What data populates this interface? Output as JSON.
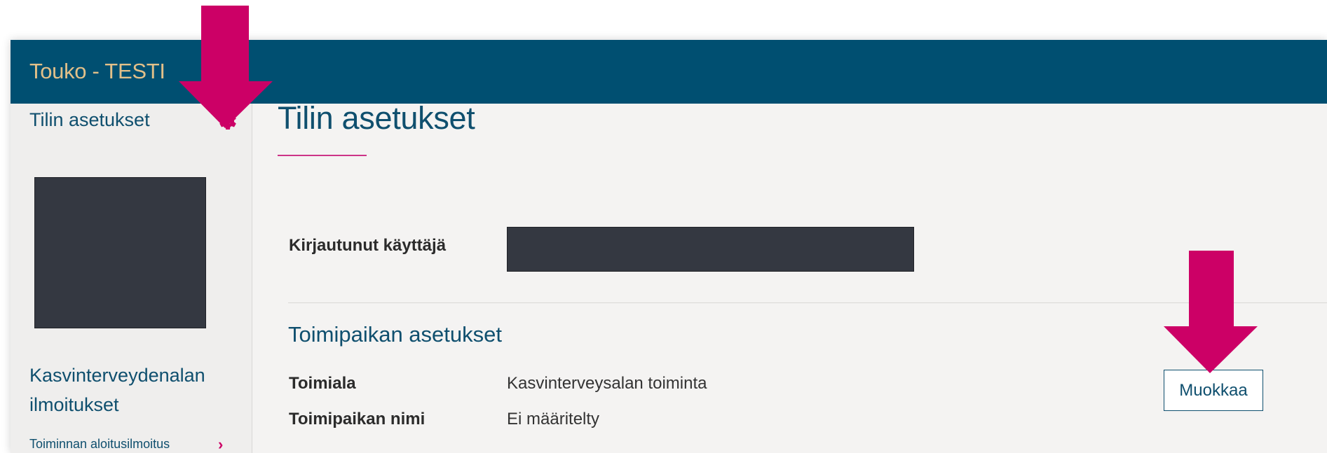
{
  "app": {
    "title": "Touko - TESTI"
  },
  "sidebar": {
    "settings_link": "Tilin asetukset",
    "settings_icon": "gear-icon",
    "section_heading": "Kasvinterveydenalan ilmoitukset",
    "items": [
      {
        "label": "Toiminnan aloitusilmoitus",
        "icon": "chevron-right-icon"
      }
    ]
  },
  "main": {
    "title": "Tilin asetukset",
    "logged_in_label": "Kirjautunut käyttäjä",
    "section_title": "Toimipaikan asetukset",
    "fields": [
      {
        "label": "Toimiala",
        "value": "Kasvinterveysalan toiminta"
      },
      {
        "label": "Toimipaikan nimi",
        "value": "Ei määritelty"
      }
    ],
    "edit_button": "Muokkaa"
  },
  "colors": {
    "header_bg": "#004f71",
    "app_title": "#e2c089",
    "heading_text": "#0f4f6e",
    "accent": "#cc0066",
    "annotation_arrow": "#cc0066",
    "redaction": "#343841",
    "page_bg": "#f4f3f2"
  }
}
